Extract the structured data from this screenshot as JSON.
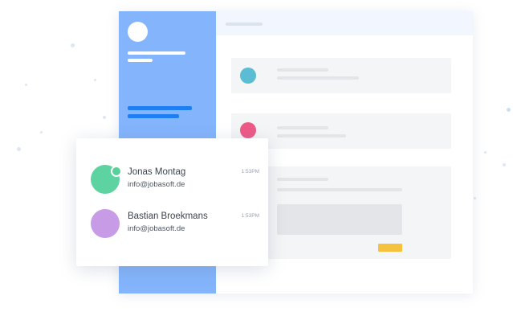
{
  "colors": {
    "sidebar": "#84b4fb",
    "sidebar_accent": "#1e7ef3",
    "topbar": "#f1f6ff",
    "card_background": "#f4f5f6",
    "avatar_teal": "#5bbdd4",
    "avatar_pink": "#ee5a86",
    "action_yellow": "#f6c23e",
    "contact_green": "#5cd3a0",
    "contact_purple": "#c79be6",
    "status_online": "#57d19a"
  },
  "contacts": [
    {
      "name": "Jonas Montag",
      "email": "info@jobasoft.de",
      "time": "1:53PM",
      "online": true
    },
    {
      "name": "Bastian Broekmans",
      "email": "info@jobasoft.de",
      "time": "1:53PM",
      "online": false
    }
  ]
}
